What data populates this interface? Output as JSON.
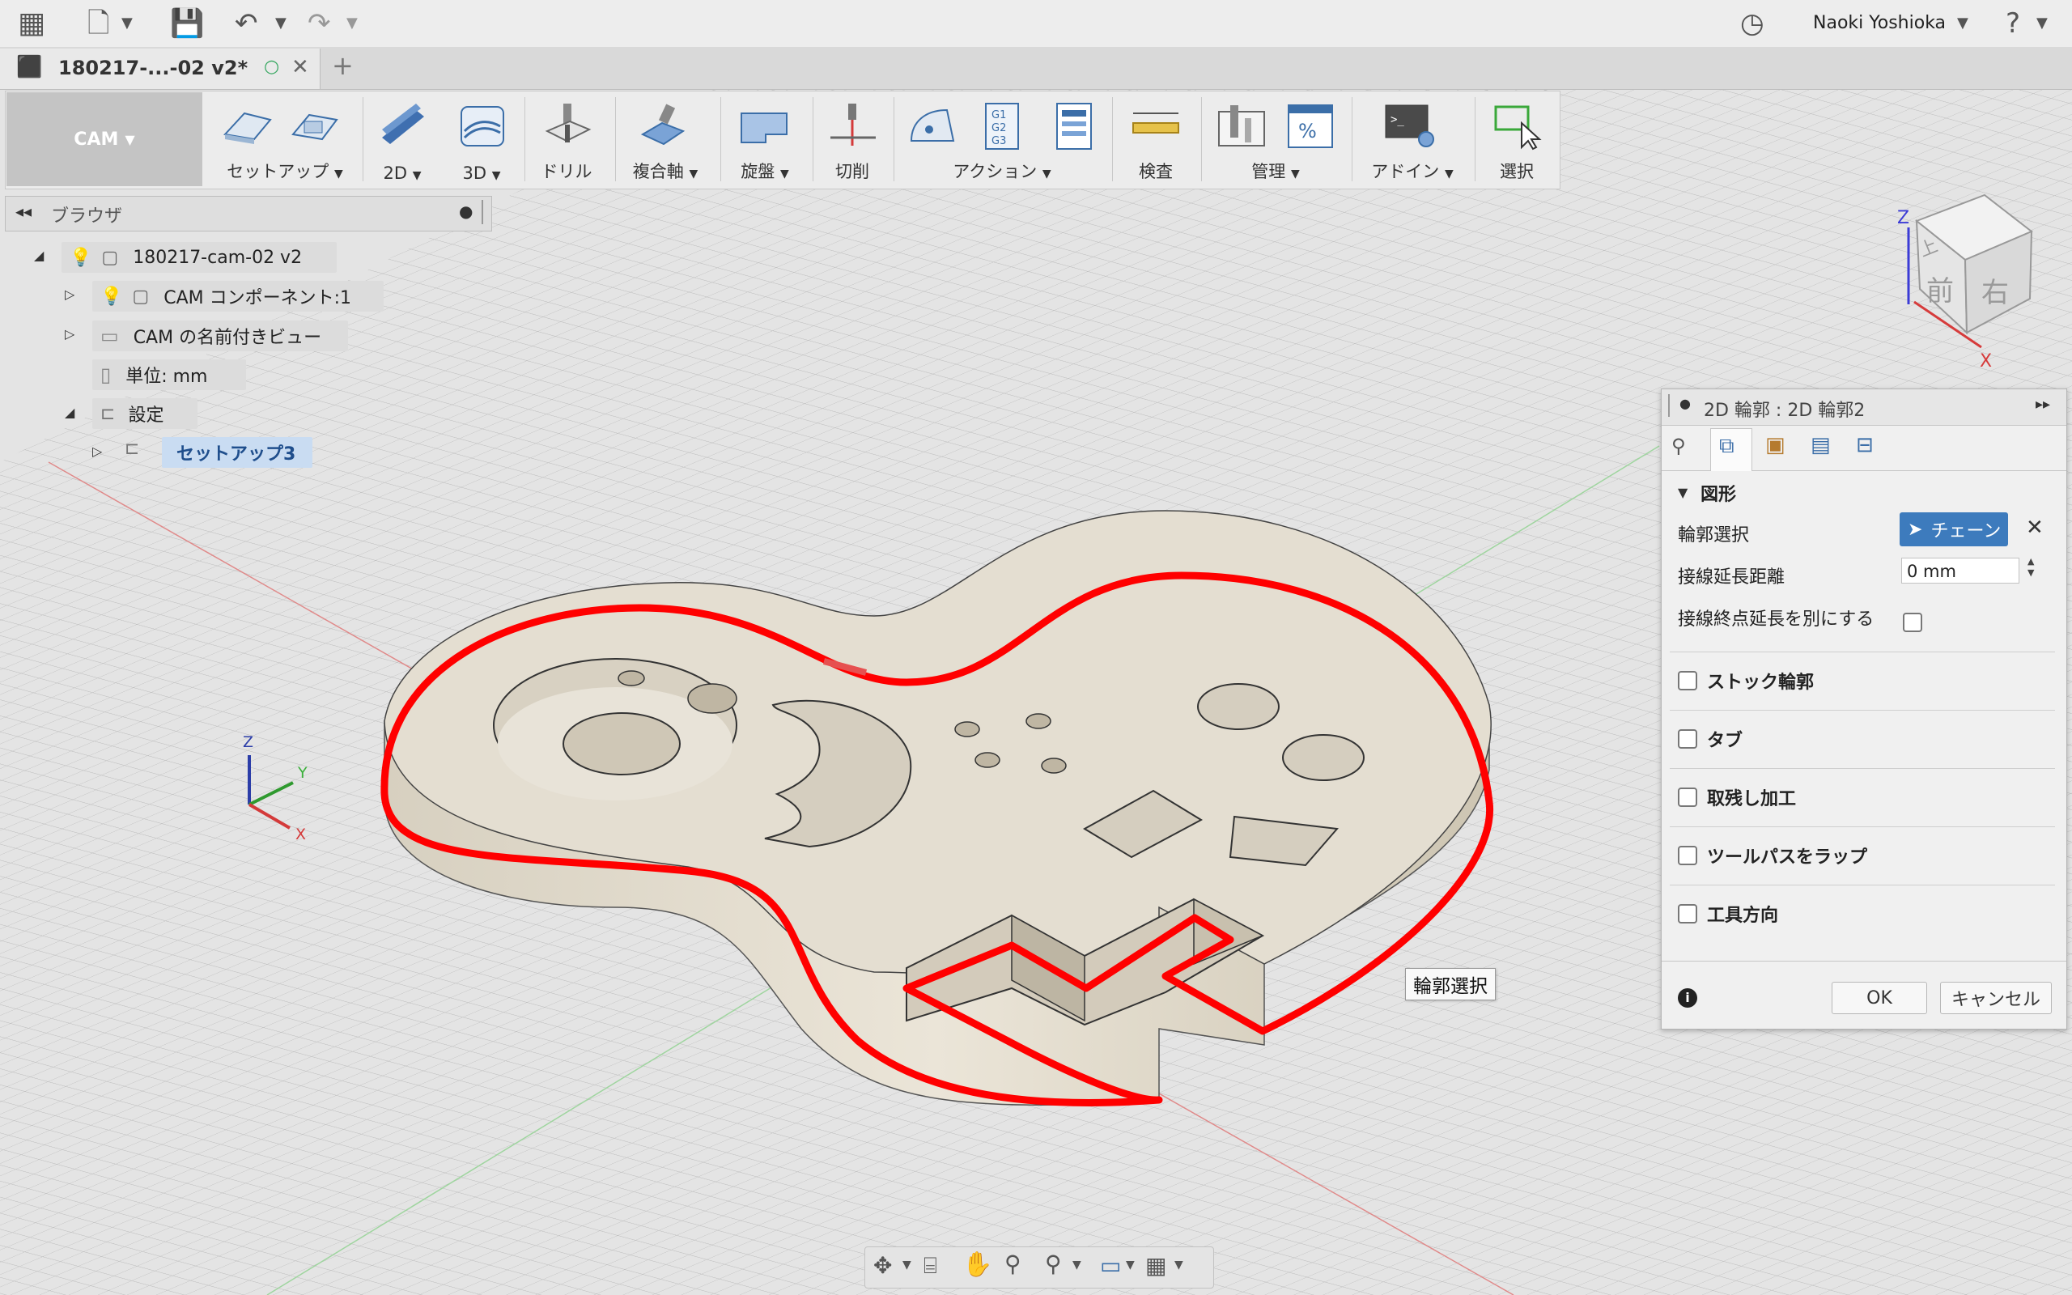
{
  "user": {
    "name": "Naoki Yoshioka"
  },
  "document": {
    "tab_title": "180217-...-02 v2*",
    "new_tab": "+"
  },
  "workspace": {
    "label": "CAM"
  },
  "ribbon": {
    "groups": [
      {
        "id": "setup",
        "label": "セットアップ"
      },
      {
        "id": "2d",
        "label": "2D"
      },
      {
        "id": "3d",
        "label": "3D"
      },
      {
        "id": "drill",
        "label": "ドリル"
      },
      {
        "id": "multiaxis",
        "label": "複合軸"
      },
      {
        "id": "lathe",
        "label": "旋盤"
      },
      {
        "id": "cutting",
        "label": "切削"
      },
      {
        "id": "actions",
        "label": "アクション"
      },
      {
        "id": "inspect",
        "label": "検査"
      },
      {
        "id": "manage",
        "label": "管理"
      },
      {
        "id": "addins",
        "label": "アドイン"
      },
      {
        "id": "select",
        "label": "選択"
      }
    ],
    "gcode_lines": [
      "G1",
      "G2",
      "G3"
    ]
  },
  "browser": {
    "title": "ブラウザ",
    "items": [
      {
        "label": "180217-cam-02 v2"
      },
      {
        "label": "CAM コンポーネント:1"
      },
      {
        "label": "CAM の名前付きビュー"
      },
      {
        "label": "単位: mm"
      },
      {
        "label": "設定"
      },
      {
        "label": "セットアップ3"
      }
    ]
  },
  "viewcube": {
    "top": "上",
    "front": "前",
    "right": "右",
    "axis_z": "Z",
    "axis_x": "X"
  },
  "triad": {
    "x": "X",
    "y": "Y",
    "z": "Z"
  },
  "panel": {
    "title": "2D 輪郭 : 2D 輪郭2",
    "section_geometry": "図形",
    "contour_selection_label": "輪郭選択",
    "chain_button": "チェーン",
    "tangential_extension_label": "接線延長距離",
    "tangential_extension_value": "0 mm",
    "separate_end_extension_label": "接線終点延長を別にする",
    "stock_contours": "ストック輪郭",
    "tabs": "タブ",
    "rest_machining": "取残し加工",
    "wrap_toolpath": "ツールパスをラップ",
    "tool_orientation": "工具方向",
    "ok": "OK",
    "cancel": "キャンセル"
  },
  "tooltip": {
    "text": "輪郭選択"
  },
  "colors": {
    "selection": "#ff0000",
    "part_top": "#e3ddd0",
    "part_side": "#cfc7b5",
    "accent": "#3d7bbd"
  }
}
